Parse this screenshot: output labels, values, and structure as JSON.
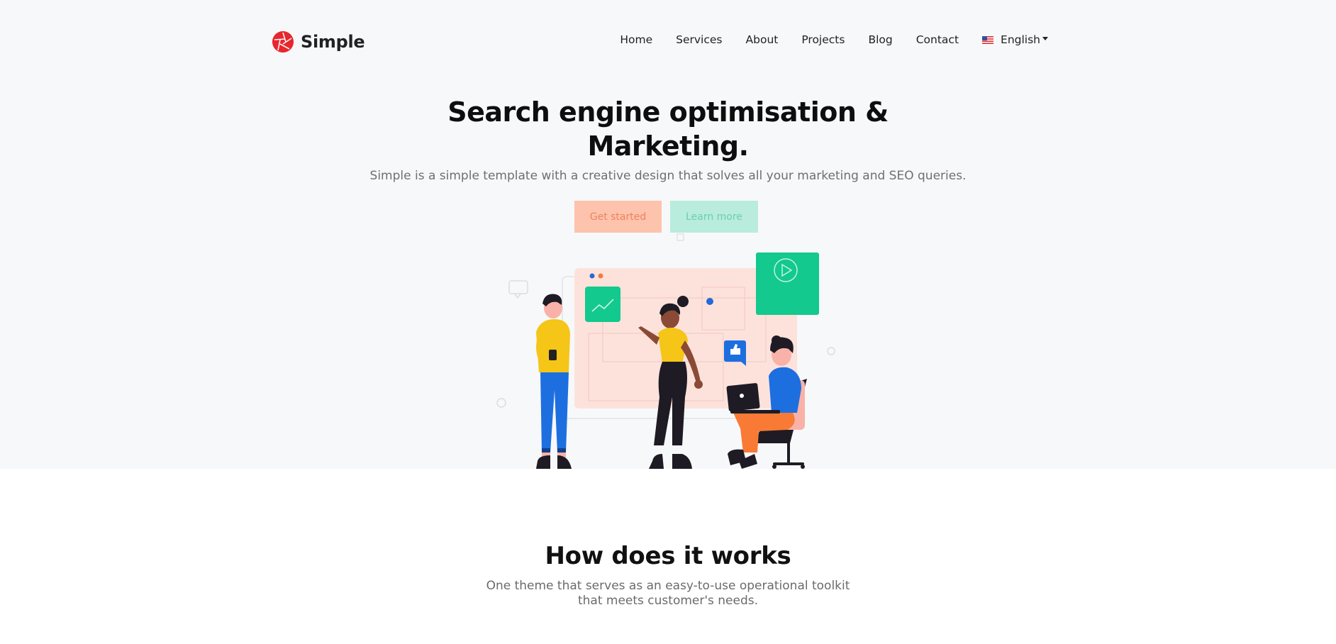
{
  "brand": {
    "name": "Simple",
    "logo_icon": "aperture-icon",
    "accent": "#e8262d"
  },
  "nav": {
    "items": [
      {
        "label": "Home"
      },
      {
        "label": "Services"
      },
      {
        "label": "About"
      },
      {
        "label": "Projects"
      },
      {
        "label": "Blog"
      },
      {
        "label": "Contact"
      }
    ],
    "language": {
      "label": "English",
      "icon": "us-flag-icon"
    }
  },
  "hero": {
    "title_line1": "Search engine optimisation &",
    "title_line2": "Marketing.",
    "subtitle": "Simple is a simple template with a creative design that solves all your marketing and SEO queries.",
    "primary_button": "Get started",
    "secondary_button": "Learn more",
    "colors": {
      "primary_bg": "#fdc3ac",
      "primary_text": "#f0825e",
      "secondary_bg": "#b9ecdc",
      "secondary_text": "#6dcfae",
      "hero_bg": "#f7f8fa"
    }
  },
  "how": {
    "title": "How does it works",
    "subtitle_line1": "One theme that serves as an easy-to-use operational toolkit",
    "subtitle_line2": "that meets customer's needs."
  }
}
